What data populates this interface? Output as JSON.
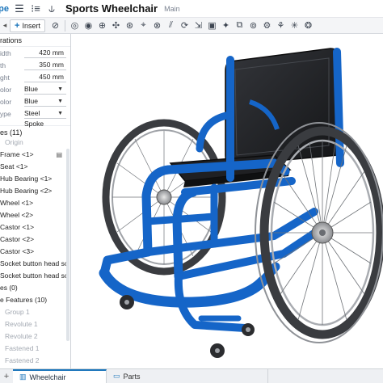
{
  "titlebar": {
    "brand": "ape",
    "doc_title": "Sports Wheelchair",
    "branch": "Main"
  },
  "toolbar": {
    "insert_label": "Insert"
  },
  "panel": {
    "config_header": "rations",
    "config_rows": [
      {
        "label": "idth",
        "value": "420 mm"
      },
      {
        "label": "th",
        "value": "350 mm"
      },
      {
        "label": "ght",
        "value": "450 mm"
      }
    ],
    "select_rows": [
      {
        "label": "olor",
        "value": "Blue"
      },
      {
        "label": "olor",
        "value": "Blue"
      },
      {
        "label": "ype",
        "value": "Steel Spoke"
      }
    ],
    "parts_header": "es (11)",
    "tree": [
      {
        "label": "Origin",
        "muted": true
      },
      {
        "label": "Frame <1>"
      },
      {
        "label": "Seat <1>"
      },
      {
        "label": "Hub Bearing <1>"
      },
      {
        "label": "Hub Bearing <2>"
      },
      {
        "label": "Wheel <1>"
      },
      {
        "label": "Wheel <2>"
      },
      {
        "label": "Castor <1>"
      },
      {
        "label": "Castor <2>"
      },
      {
        "label": "Castor <3>"
      },
      {
        "label": "Socket button head sc..."
      },
      {
        "label": "Socket button head sc..."
      },
      {
        "label": "es (0)"
      },
      {
        "label": "e Features (10)"
      },
      {
        "label": "Group 1",
        "muted": true
      },
      {
        "label": "Revolute 1",
        "muted": true
      },
      {
        "label": "Revolute 2",
        "muted": true
      },
      {
        "label": "Fastened 1",
        "muted": true
      },
      {
        "label": "Fastened 2",
        "muted": true
      }
    ]
  },
  "tabs": {
    "active": "Wheelchair",
    "other": "Parts"
  },
  "colors": {
    "frame_blue": "#1565c8",
    "seat_black": "#1c1d20",
    "tire_grey": "#3a3c40"
  }
}
